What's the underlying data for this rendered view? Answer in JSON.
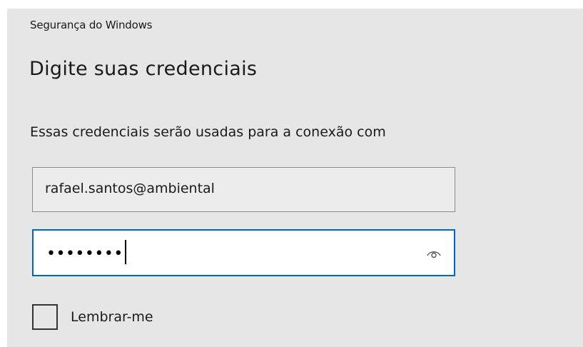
{
  "window": {
    "title": "Segurança do Windows"
  },
  "dialog": {
    "heading": "Digite suas credenciais",
    "description": "Essas credenciais serão usadas para a conexão com"
  },
  "username": {
    "value": "rafael.santos@ambiental"
  },
  "password": {
    "masked_value": "••••••••",
    "reveal_icon": "eye-icon"
  },
  "remember": {
    "label": "Lembrar-me",
    "checked": false
  },
  "colors": {
    "background": "#e6e6e6",
    "focus_border": "#0067c0",
    "text": "#1a1a1a"
  }
}
